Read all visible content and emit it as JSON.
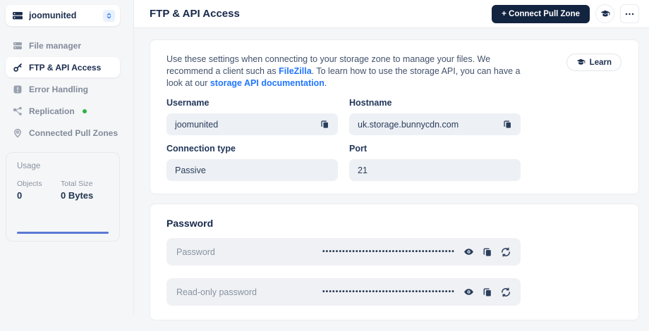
{
  "colors": {
    "accent_navy": "#132440",
    "link_blue": "#2176FF",
    "status_green": "#2FB344",
    "usage_bar_blue": "#5B79D6"
  },
  "sidebar": {
    "zone_selector": {
      "name": "joomunited",
      "icon": "storage-zone-icon"
    },
    "items": [
      {
        "label": "File manager",
        "icon": "file-manager-icon",
        "active": false
      },
      {
        "label": "FTP & API Access",
        "icon": "key-icon",
        "active": true
      },
      {
        "label": "Error Handling",
        "icon": "error-icon",
        "active": false
      },
      {
        "label": "Replication",
        "icon": "replication-icon",
        "active": false,
        "green_dot": true
      },
      {
        "label": "Connected Pull Zones",
        "icon": "map-pin-icon",
        "active": false
      }
    ],
    "usage": {
      "title": "Usage",
      "stats": [
        {
          "label": "Objects",
          "value": "0"
        },
        {
          "label": "Total Size",
          "value": "0 Bytes"
        }
      ]
    }
  },
  "header": {
    "title": "FTP & API Access",
    "connect_button_label": "+ Connect Pull Zone",
    "icon_buttons": [
      "graduation-cap-icon",
      "ellipsis-icon"
    ]
  },
  "main": {
    "info_card": {
      "description": {
        "part1": "Use these settings when connecting to your storage zone to manage your files. We recommend a client such as ",
        "link_filezilla": "FileZilla",
        "part2": ". To learn how to use the storage API, you can have a look at our ",
        "link_docs": "storage API documentation",
        "part3": "."
      },
      "learn_button_label": "Learn",
      "fields": [
        {
          "label": "Username",
          "value": "joomunited",
          "copyable": true
        },
        {
          "label": "Hostname",
          "value": "uk.storage.bunnycdn.com",
          "copyable": true
        },
        {
          "label": "Connection type",
          "value": "Passive",
          "copyable": false
        },
        {
          "label": "Port",
          "value": "21",
          "copyable": false
        }
      ]
    },
    "password_card": {
      "title": "Password",
      "rows": [
        {
          "label": "Password",
          "masked_value": "••••••••••••••••••••••••••••••••••••••••"
        },
        {
          "label": "Read-only password",
          "masked_value": "••••••••••••••••••••••••••••••••••••••••"
        }
      ]
    }
  }
}
